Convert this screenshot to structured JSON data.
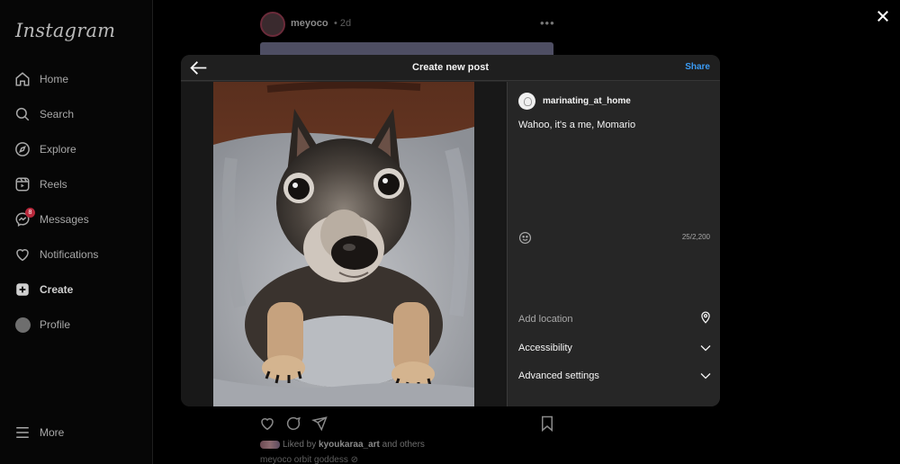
{
  "sidebar": {
    "logo": "Instagram",
    "items": [
      {
        "label": "Home",
        "icon": "home-icon"
      },
      {
        "label": "Search",
        "icon": "search-icon"
      },
      {
        "label": "Explore",
        "icon": "compass-icon"
      },
      {
        "label": "Reels",
        "icon": "reels-icon"
      },
      {
        "label": "Messages",
        "icon": "messenger-icon",
        "badge": "8"
      },
      {
        "label": "Notifications",
        "icon": "heart-icon"
      },
      {
        "label": "Create",
        "icon": "plus-square-icon"
      },
      {
        "label": "Profile",
        "icon": "avatar-icon"
      }
    ],
    "more": {
      "label": "More",
      "icon": "menu-icon"
    }
  },
  "feed": {
    "username": "meyoco",
    "time": "• 2d",
    "liked_by_prefix": "Liked by",
    "liked_by_user": "kyoukaraa_art",
    "liked_by_suffix": "and others",
    "caption_preview": "meyoco orbit goddess ⊘"
  },
  "modal": {
    "title": "Create new post",
    "share_label": "Share",
    "author": "marinating_at_home",
    "caption": "Wahoo, it's a me, Momario",
    "char_count": "25/2,200",
    "location_placeholder": "Add location",
    "accessibility_label": "Accessibility",
    "advanced_label": "Advanced settings"
  },
  "colors": {
    "background": "#000000",
    "modal": "#262626",
    "accent": "#3b9bf4",
    "badge": "#b8283b"
  }
}
